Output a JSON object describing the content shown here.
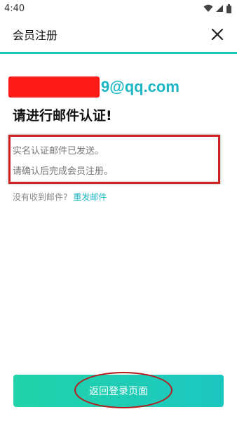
{
  "status_bar": {
    "time": "4:40",
    "icons": [
      "wifi-icon",
      "signal-icon",
      "battery-icon"
    ]
  },
  "header": {
    "title": "会员注册",
    "close_icon": "close-icon"
  },
  "email": {
    "visible_suffix": "9@qq.com",
    "redacted": true
  },
  "main": {
    "heading": "请进行邮件认证!",
    "message_lines": [
      "实名认证邮件已发送。",
      "请确认后完成会员注册。"
    ],
    "resend_hint": "没有收到邮件?",
    "resend_link": "重发邮件"
  },
  "footer": {
    "button_label": "返回登录页面"
  },
  "colors": {
    "accent": "#1cc7b3",
    "email_text": "#1cb6c4",
    "redaction": "#ff1a1a",
    "annotation": "#cc2222",
    "button_start": "#22d3a9",
    "button_end": "#1cc6c0"
  }
}
